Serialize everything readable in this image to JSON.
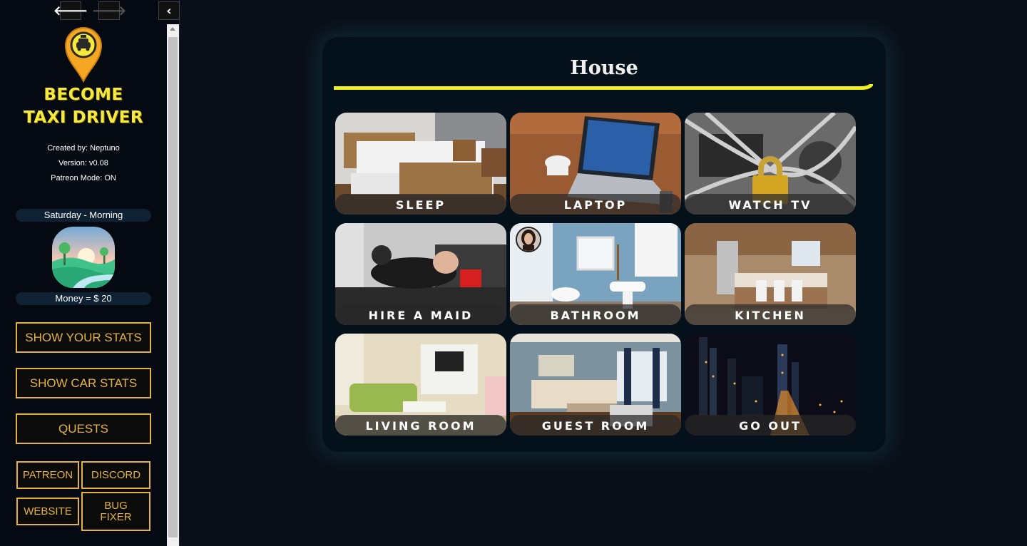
{
  "nav": {
    "back_icon": "arrow-left-icon",
    "forward_icon": "arrow-right-icon",
    "collapse_icon": "chevron-left-icon"
  },
  "sidebar": {
    "logo_line1": "BECOME",
    "logo_line2": "TAXI DRIVER",
    "created_by": "Created by: Neptuno",
    "version": "Version: v0.08",
    "patreon_mode": "Patreon Mode: ON",
    "time": "Saturday - Morning",
    "money": "Money = $ 20",
    "buttons": {
      "stats": "SHOW YOUR STATS",
      "car": "SHOW CAR STATS",
      "quests": "QUESTS",
      "patreon": "PATREON",
      "discord": "DISCORD",
      "website": "WEBSITE",
      "bug_fixer": "BUG FIXER"
    },
    "accent_color": "#e3b341",
    "logo_color": "#f7e93b"
  },
  "main": {
    "title": "House",
    "underline_color": "#f2f21a",
    "tiles": [
      {
        "label": "SLEEP"
      },
      {
        "label": "LAPTOP"
      },
      {
        "label": "WATCH TV"
      },
      {
        "label": "HIRE A MAID"
      },
      {
        "label": "BATHROOM"
      },
      {
        "label": "KITCHEN"
      },
      {
        "label": "LIVING ROOM"
      },
      {
        "label": "GUEST ROOM"
      },
      {
        "label": "GO OUT"
      }
    ]
  }
}
